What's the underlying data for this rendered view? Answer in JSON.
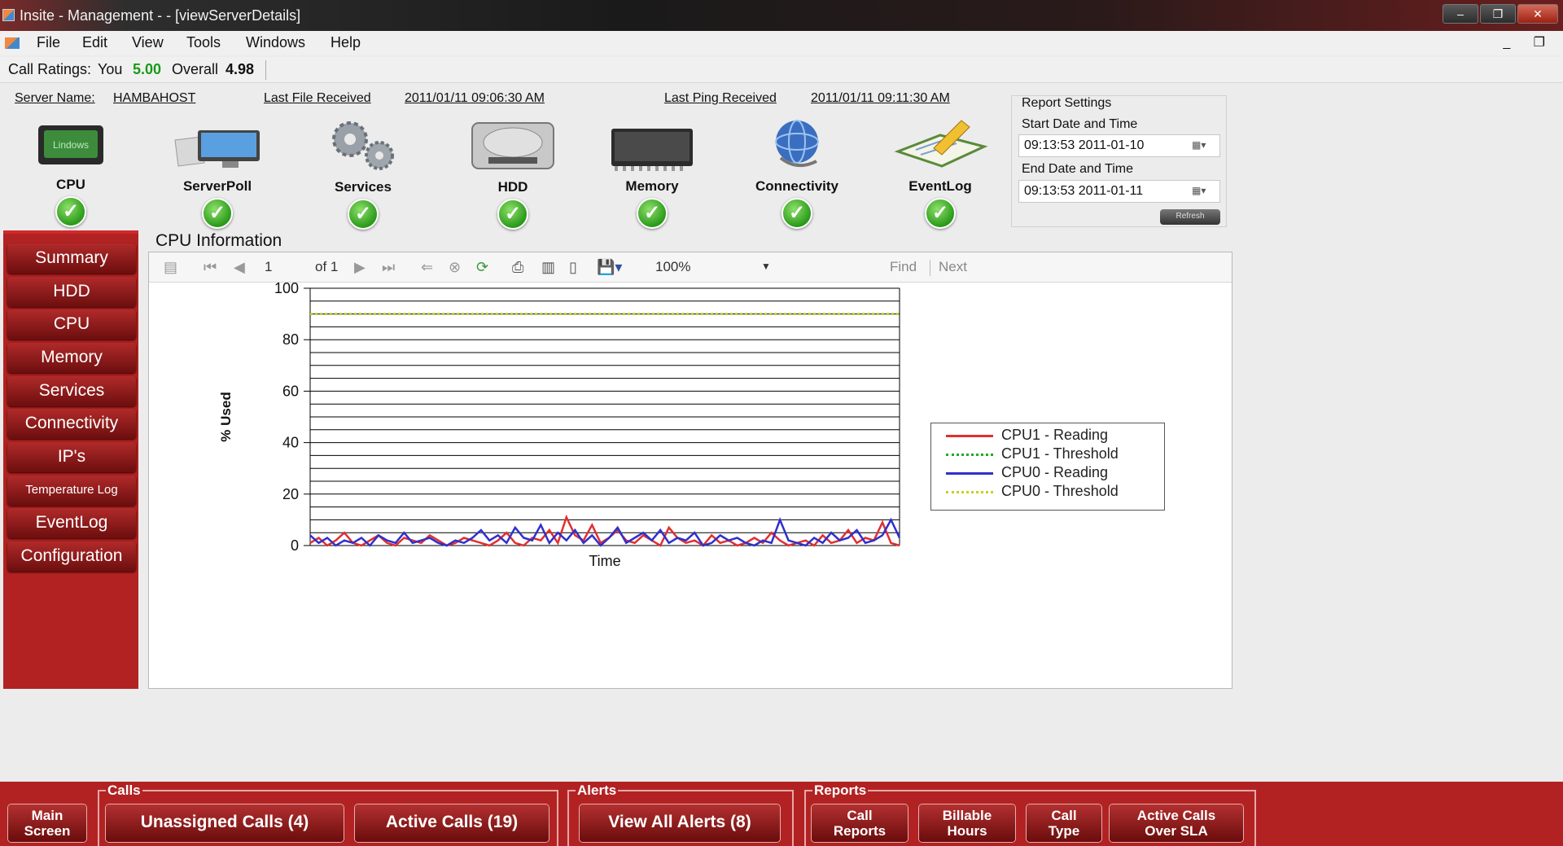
{
  "window": {
    "title": "Insite - Management -  - [viewServerDetails]"
  },
  "menu": [
    "File",
    "Edit",
    "View",
    "Tools",
    "Windows",
    "Help"
  ],
  "ratings": {
    "label": "Call Ratings:",
    "you_label": "You",
    "you_value": "5.00",
    "overall_label": "Overall",
    "overall_value": "4.98"
  },
  "server": {
    "name_label": "Server Name:",
    "name_value": "HAMBAHOST",
    "file_label": "Last File Received",
    "file_value": "2011/01/11 09:06:30 AM",
    "ping_label": "Last Ping Received",
    "ping_value": "2011/01/11 09:11:30 AM"
  },
  "status_items": [
    {
      "label": "CPU",
      "icon": "cpu-chip-icon",
      "status": "ok"
    },
    {
      "label": "ServerPoll",
      "icon": "monitor-icon",
      "status": "ok"
    },
    {
      "label": "Services",
      "icon": "gears-icon",
      "status": "ok"
    },
    {
      "label": "HDD",
      "icon": "hard-drive-icon",
      "status": "ok"
    },
    {
      "label": "Memory",
      "icon": "memory-chip-icon",
      "status": "ok"
    },
    {
      "label": "Connectivity",
      "icon": "globe-network-icon",
      "status": "ok"
    },
    {
      "label": "EventLog",
      "icon": "notebook-pencil-icon",
      "status": "ok"
    }
  ],
  "report_settings": {
    "title": "Report Settings",
    "start_label": "Start Date and Time",
    "start_value": "09:13:53 2011-01-10",
    "end_label": "End Date and Time",
    "end_value": "09:13:53 2011-01-11",
    "refresh_label": "Refresh"
  },
  "sidebar": [
    "Summary",
    "HDD",
    "CPU",
    "Memory",
    "Services",
    "Connectivity",
    "IP's",
    "Temperature Log",
    "EventLog",
    "Configuration"
  ],
  "panel_title": "CPU Information",
  "toolbar": {
    "page": "1",
    "of": "of 1",
    "zoom": "100%",
    "find": "Find",
    "next": "Next"
  },
  "chart_data": {
    "type": "line",
    "title": "",
    "xlabel": "Time",
    "ylabel": "% Used",
    "ylim": [
      0,
      100
    ],
    "yticks": [
      0,
      20,
      40,
      60,
      80,
      100
    ],
    "grid": true,
    "legend_position": "right",
    "series": [
      {
        "name": "CPU1 - Reading",
        "color": "#e03030",
        "style": "solid",
        "values": [
          1,
          3,
          0,
          2,
          5,
          1,
          0,
          2,
          4,
          1,
          0,
          3,
          2,
          1,
          4,
          2,
          0,
          1,
          3,
          2,
          1,
          0,
          2,
          5,
          1,
          0,
          3,
          2,
          6,
          1,
          11,
          4,
          2,
          8,
          1,
          3,
          6,
          2,
          1,
          4,
          2,
          0,
          7,
          3,
          1,
          2,
          0,
          4,
          1,
          2,
          0,
          1,
          3,
          1,
          5,
          2,
          0,
          1,
          2,
          0,
          4,
          1,
          2,
          6,
          1,
          3,
          2,
          9,
          1,
          0
        ]
      },
      {
        "name": "CPU1 - Threshold",
        "color": "#22aa22",
        "style": "dotted",
        "values": [
          90,
          90,
          90,
          90,
          90,
          90,
          90,
          90,
          90,
          90,
          90,
          90,
          90,
          90,
          90,
          90,
          90,
          90,
          90,
          90,
          90,
          90,
          90,
          90,
          90,
          90,
          90,
          90,
          90,
          90,
          90,
          90,
          90,
          90,
          90,
          90,
          90,
          90,
          90,
          90,
          90,
          90,
          90,
          90,
          90,
          90,
          90,
          90,
          90,
          90,
          90,
          90,
          90,
          90,
          90,
          90,
          90,
          90,
          90,
          90,
          90,
          90,
          90,
          90,
          90,
          90,
          90,
          90,
          90,
          90
        ]
      },
      {
        "name": "CPU0 - Reading",
        "color": "#3030cc",
        "style": "solid",
        "values": [
          4,
          1,
          3,
          0,
          2,
          1,
          3,
          0,
          4,
          2,
          1,
          5,
          1,
          2,
          3,
          1,
          0,
          2,
          1,
          3,
          6,
          2,
          4,
          1,
          7,
          3,
          2,
          8,
          1,
          5,
          2,
          6,
          1,
          4,
          0,
          3,
          7,
          1,
          3,
          5,
          2,
          6,
          1,
          3,
          2,
          5,
          0,
          1,
          4,
          2,
          3,
          1,
          0,
          2,
          1,
          10,
          2,
          1,
          0,
          3,
          1,
          5,
          2,
          3,
          6,
          1,
          2,
          4,
          10,
          3
        ]
      },
      {
        "name": "CPU0 - Threshold",
        "color": "#c8d020",
        "style": "dotted",
        "values": [
          90,
          90,
          90,
          90,
          90,
          90,
          90,
          90,
          90,
          90,
          90,
          90,
          90,
          90,
          90,
          90,
          90,
          90,
          90,
          90,
          90,
          90,
          90,
          90,
          90,
          90,
          90,
          90,
          90,
          90,
          90,
          90,
          90,
          90,
          90,
          90,
          90,
          90,
          90,
          90,
          90,
          90,
          90,
          90,
          90,
          90,
          90,
          90,
          90,
          90,
          90,
          90,
          90,
          90,
          90,
          90,
          90,
          90,
          90,
          90,
          90,
          90,
          90,
          90,
          90,
          90,
          90,
          90,
          90,
          90
        ]
      }
    ]
  },
  "bottom": {
    "main_screen": "Main\nScreen",
    "calls_group": "Calls",
    "unassigned": "Unassigned Calls (4)",
    "active": "Active Calls (19)",
    "alerts_group": "Alerts",
    "view_alerts": "View All Alerts (8)",
    "reports_group": "Reports",
    "call_reports": "Call\nReports",
    "billable": "Billable\nHours",
    "call_type": "Call\nType",
    "active_sla": "Active Calls\nOver SLA"
  }
}
